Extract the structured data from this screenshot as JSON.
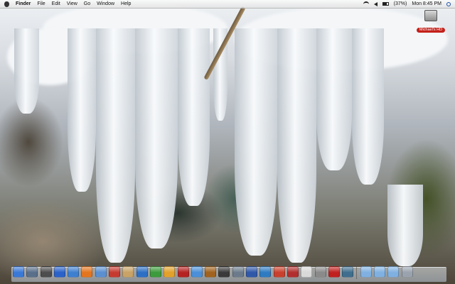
{
  "menubar": {
    "apple": "apple-menu",
    "app_name": "Finder",
    "menus": [
      "File",
      "Edit",
      "View",
      "Go",
      "Window",
      "Help"
    ],
    "battery": "(37%)",
    "clock": "Mon 8:45 PM"
  },
  "desktop": {
    "hard_drive_label": "Michael's HD"
  },
  "dock": {
    "apps": [
      {
        "name": "finder-icon",
        "color": "#3a78d6"
      },
      {
        "name": "dashboard-icon",
        "color": "#5a6f8a"
      },
      {
        "name": "system-preferences-icon",
        "color": "#4d4d4d"
      },
      {
        "name": "safari-icon",
        "color": "#2a62c9"
      },
      {
        "name": "globe-icon",
        "color": "#3e7fcf"
      },
      {
        "name": "firefox-icon",
        "color": "#e3751f"
      },
      {
        "name": "clock-icon",
        "color": "#5b8fd0"
      },
      {
        "name": "ical-icon",
        "color": "#c53a30"
      },
      {
        "name": "address-book-icon",
        "color": "#c8a266"
      },
      {
        "name": "utility-icon",
        "color": "#2d6fc4"
      },
      {
        "name": "pinwheel-icon",
        "color": "#3c9b3c"
      },
      {
        "name": "pages-icon",
        "color": "#e2a12a"
      },
      {
        "name": "photo-booth-icon",
        "color": "#b52222"
      },
      {
        "name": "itunes-icon",
        "color": "#4a8fd8"
      },
      {
        "name": "guitar-icon",
        "color": "#a0621e"
      },
      {
        "name": "imovie-icon",
        "color": "#3a3a3a"
      },
      {
        "name": "preview-icon",
        "color": "#6c7b8b"
      },
      {
        "name": "quicktime-icon",
        "color": "#2f58a8"
      },
      {
        "name": "keynote-icon",
        "color": "#2f7bc1"
      },
      {
        "name": "photo-icon",
        "color": "#c9402c"
      },
      {
        "name": "book-icon",
        "color": "#b22f2f"
      },
      {
        "name": "calendar-icon",
        "color": "#d9d9d9"
      },
      {
        "name": "disk-utility-icon",
        "color": "#8a8a8a"
      },
      {
        "name": "lock-icon",
        "color": "#c02020"
      },
      {
        "name": "network-icon",
        "color": "#3f6e8e"
      }
    ],
    "stacks": [
      {
        "name": "applications-folder-icon",
        "color": "#7fb0e0"
      },
      {
        "name": "documents-folder-icon",
        "color": "#7fb0e0"
      },
      {
        "name": "downloads-folder-icon",
        "color": "#7fb0e0"
      },
      {
        "name": "trash-icon",
        "color": "#9aa3ad"
      }
    ]
  }
}
